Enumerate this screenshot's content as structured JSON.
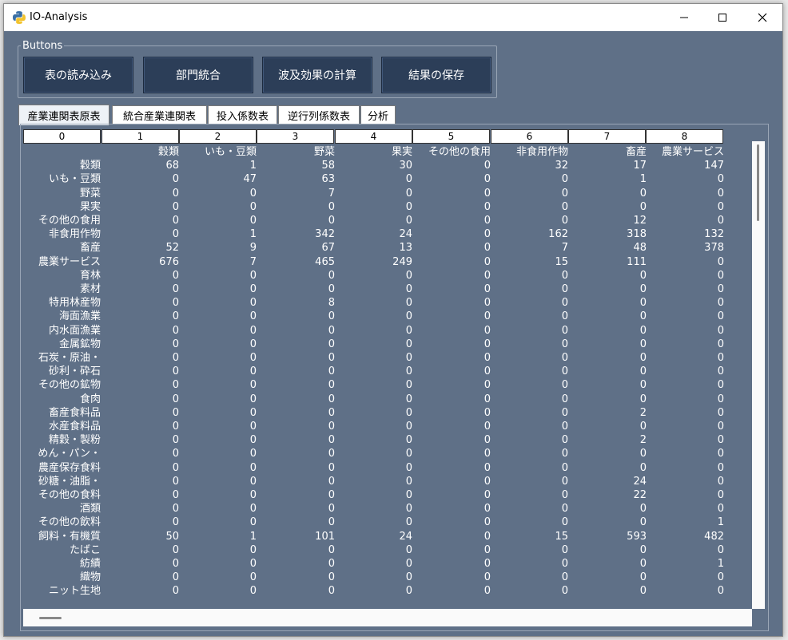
{
  "window": {
    "title": "IO-Analysis"
  },
  "buttons_group": {
    "label": "Buttons",
    "buttons": [
      "表の読み込み",
      "部門統合",
      "波及効果の計算",
      "結果の保存"
    ]
  },
  "tabs": [
    "産業連関表原表",
    "統合産業連関表",
    "投入係数表",
    "逆行列係数表",
    "分析"
  ],
  "table": {
    "column_headers": [
      "0",
      "1",
      "2",
      "3",
      "4",
      "5",
      "6",
      "7",
      "8"
    ],
    "rows": [
      [
        "",
        "穀類",
        "いも・豆類",
        "野菜",
        "果実",
        "その他の食用",
        "非食用作物",
        "畜産",
        "農業サービス"
      ],
      [
        "穀類",
        "68",
        "1",
        "58",
        "30",
        "0",
        "32",
        "17",
        "147"
      ],
      [
        "いも・豆類",
        "0",
        "47",
        "63",
        "0",
        "0",
        "0",
        "1",
        "0"
      ],
      [
        "野菜",
        "0",
        "0",
        "7",
        "0",
        "0",
        "0",
        "0",
        "0"
      ],
      [
        "果実",
        "0",
        "0",
        "0",
        "0",
        "0",
        "0",
        "0",
        "0"
      ],
      [
        "その他の食用",
        "0",
        "0",
        "0",
        "0",
        "0",
        "0",
        "12",
        "0"
      ],
      [
        "非食用作物",
        "0",
        "1",
        "342",
        "24",
        "0",
        "162",
        "318",
        "132"
      ],
      [
        "畜産",
        "52",
        "9",
        "67",
        "13",
        "0",
        "7",
        "48",
        "378"
      ],
      [
        "農業サービス",
        "676",
        "7",
        "465",
        "249",
        "0",
        "15",
        "111",
        "0"
      ],
      [
        "育林",
        "0",
        "0",
        "0",
        "0",
        "0",
        "0",
        "0",
        "0"
      ],
      [
        "素材",
        "0",
        "0",
        "0",
        "0",
        "0",
        "0",
        "0",
        "0"
      ],
      [
        "特用林産物",
        "0",
        "0",
        "8",
        "0",
        "0",
        "0",
        "0",
        "0"
      ],
      [
        "海面漁業",
        "0",
        "0",
        "0",
        "0",
        "0",
        "0",
        "0",
        "0"
      ],
      [
        "内水面漁業",
        "0",
        "0",
        "0",
        "0",
        "0",
        "0",
        "0",
        "0"
      ],
      [
        "金属鉱物",
        "0",
        "0",
        "0",
        "0",
        "0",
        "0",
        "0",
        "0"
      ],
      [
        "石炭・原油・",
        "0",
        "0",
        "0",
        "0",
        "0",
        "0",
        "0",
        "0"
      ],
      [
        "砂利・砕石",
        "0",
        "0",
        "0",
        "0",
        "0",
        "0",
        "0",
        "0"
      ],
      [
        "その他の鉱物",
        "0",
        "0",
        "0",
        "0",
        "0",
        "0",
        "0",
        "0"
      ],
      [
        "食肉",
        "0",
        "0",
        "0",
        "0",
        "0",
        "0",
        "0",
        "0"
      ],
      [
        "畜産食料品",
        "0",
        "0",
        "0",
        "0",
        "0",
        "0",
        "2",
        "0"
      ],
      [
        "水産食料品",
        "0",
        "0",
        "0",
        "0",
        "0",
        "0",
        "0",
        "0"
      ],
      [
        "精穀・製粉",
        "0",
        "0",
        "0",
        "0",
        "0",
        "0",
        "2",
        "0"
      ],
      [
        "めん・パン・",
        "0",
        "0",
        "0",
        "0",
        "0",
        "0",
        "0",
        "0"
      ],
      [
        "農産保存食料",
        "0",
        "0",
        "0",
        "0",
        "0",
        "0",
        "0",
        "0"
      ],
      [
        "砂糖・油脂・",
        "0",
        "0",
        "0",
        "0",
        "0",
        "0",
        "24",
        "0"
      ],
      [
        "その他の食料",
        "0",
        "0",
        "0",
        "0",
        "0",
        "0",
        "22",
        "0"
      ],
      [
        "酒類",
        "0",
        "0",
        "0",
        "0",
        "0",
        "0",
        "0",
        "0"
      ],
      [
        "その他の飲料",
        "0",
        "0",
        "0",
        "0",
        "0",
        "0",
        "0",
        "1"
      ],
      [
        "飼料・有機質",
        "50",
        "1",
        "101",
        "24",
        "0",
        "15",
        "593",
        "482"
      ],
      [
        "たばこ",
        "0",
        "0",
        "0",
        "0",
        "0",
        "0",
        "0",
        "0"
      ],
      [
        "紡績",
        "0",
        "0",
        "0",
        "0",
        "0",
        "0",
        "0",
        "1"
      ],
      [
        "織物",
        "0",
        "0",
        "0",
        "0",
        "0",
        "0",
        "0",
        "0"
      ],
      [
        "ニット生地",
        "0",
        "0",
        "0",
        "0",
        "0",
        "0",
        "0",
        "0"
      ]
    ]
  },
  "colors": {
    "background": "#5f7087",
    "button": "#2c3e58",
    "text": "#ffffff"
  },
  "icons": {
    "app": "python-logo-icon",
    "minimize": "minimize-icon",
    "maximize": "maximize-icon",
    "close": "close-icon"
  }
}
